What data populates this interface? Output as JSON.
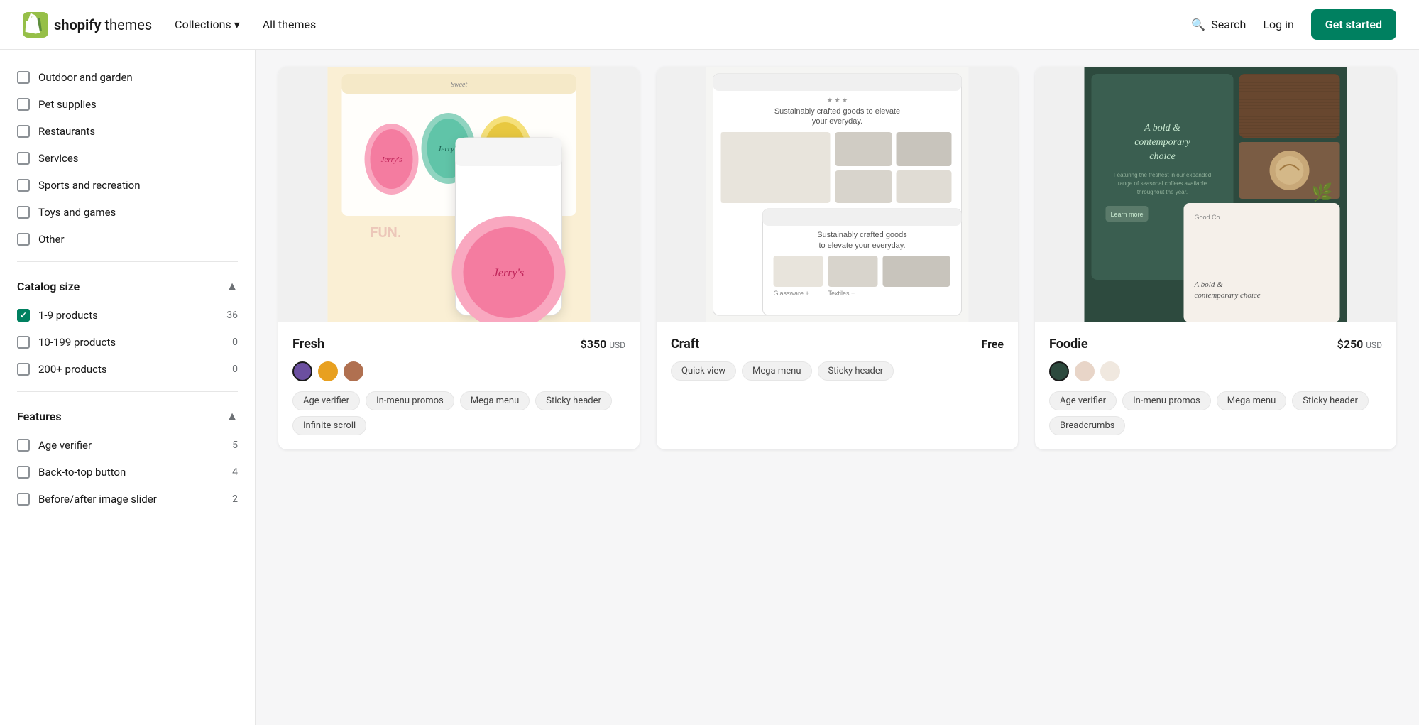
{
  "header": {
    "logo_text": "shopify",
    "logo_bold": "themes",
    "nav": {
      "collections_label": "Collections",
      "all_themes_label": "All themes"
    },
    "search_label": "Search",
    "login_label": "Log in",
    "get_started_label": "Get started"
  },
  "sidebar": {
    "categories": [
      {
        "id": "outdoor-garden",
        "label": "Outdoor and garden",
        "checked": false
      },
      {
        "id": "pet-supplies",
        "label": "Pet supplies",
        "checked": false
      },
      {
        "id": "restaurants",
        "label": "Restaurants",
        "checked": false
      },
      {
        "id": "services",
        "label": "Services",
        "checked": false
      },
      {
        "id": "sports-recreation",
        "label": "Sports and recreation",
        "checked": false
      },
      {
        "id": "toys-games",
        "label": "Toys and games",
        "checked": false
      },
      {
        "id": "other",
        "label": "Other",
        "checked": false
      }
    ],
    "catalog_size_title": "Catalog size",
    "catalog_items": [
      {
        "id": "1-9",
        "label": "1-9 products",
        "count": 36,
        "checked": true
      },
      {
        "id": "10-199",
        "label": "10-199 products",
        "count": 0,
        "checked": false
      },
      {
        "id": "200plus",
        "label": "200+ products",
        "count": 0,
        "checked": false
      }
    ],
    "features_title": "Features",
    "feature_items": [
      {
        "id": "age-verifier",
        "label": "Age verifier",
        "count": 5,
        "checked": false
      },
      {
        "id": "back-to-top",
        "label": "Back-to-top button",
        "count": 4,
        "checked": false
      },
      {
        "id": "before-after-slider",
        "label": "Before/after image slider",
        "count": 2,
        "checked": false
      }
    ]
  },
  "themes": [
    {
      "id": "fresh",
      "name": "Fresh",
      "price": "$350",
      "price_unit": "USD",
      "is_free": false,
      "colors": [
        {
          "hex": "#6b4fa0",
          "active": true
        },
        {
          "hex": "#e8a020",
          "active": false
        },
        {
          "hex": "#b07050",
          "active": false
        }
      ],
      "tags": [
        "Age verifier",
        "In-menu promos",
        "Mega menu",
        "Sticky header",
        "Infinite scroll"
      ],
      "preview_bg": "#faefd4"
    },
    {
      "id": "craft",
      "name": "Craft",
      "price": "Free",
      "is_free": true,
      "colors": [],
      "tags": [
        "Quick view",
        "Mega menu",
        "Sticky header"
      ],
      "preview_bg": "#f5f5f5"
    },
    {
      "id": "foodie",
      "name": "Foodie",
      "price": "$250",
      "price_unit": "USD",
      "is_free": false,
      "colors": [
        {
          "hex": "#2d4a3e",
          "active": true
        },
        {
          "hex": "#e8d5c8",
          "active": false
        },
        {
          "hex": "#f0e8df",
          "active": false
        }
      ],
      "tags": [
        "Age verifier",
        "In-menu promos",
        "Mega menu",
        "Sticky header",
        "Breadcrumbs"
      ],
      "preview_bg": "#2d4a3e"
    }
  ]
}
